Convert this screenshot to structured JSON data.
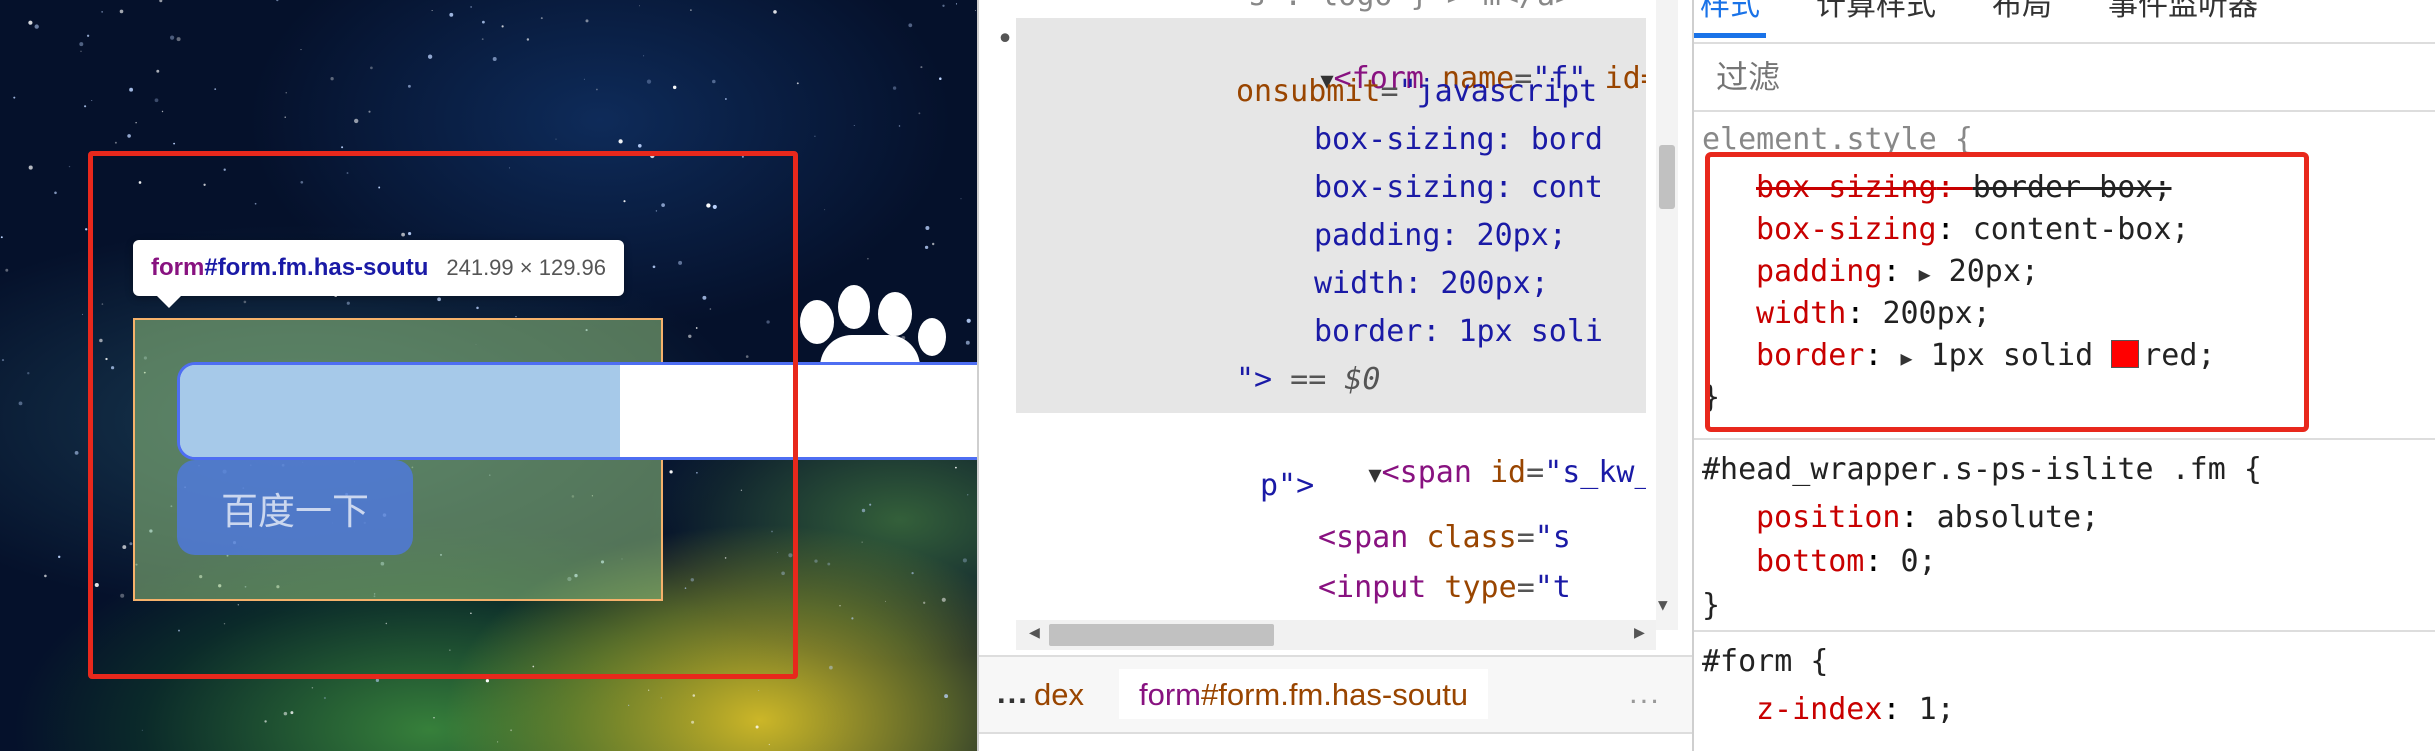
{
  "preview": {
    "submit_button": "百度一下",
    "tooltip": {
      "selector_tag": "form",
      "selector_rest": "#form.fm.has-soutu",
      "size": "241.99 × 129.96"
    },
    "colors": {
      "highlight_box": "#e8281c",
      "search_border": "#4e6ef2",
      "content_overlay": "#6fa8dc",
      "padding_overlay": "#93c47d",
      "margin_outline": "#f6b26b"
    }
  },
  "elements_panel": {
    "gutter": "•••",
    "lines": [
      {
        "caret": "▼",
        "open": "<form",
        "attr1": " name",
        "eq1": "=",
        "val1": "\"f\"",
        "attr2": " id="
      },
      {
        "attr": "onsubmit",
        "eq": "=",
        "val": "\"javascript"
      },
      {
        "text": "box-sizing: bord"
      },
      {
        "text": "box-sizing: cont"
      },
      {
        "text": "padding: 20px;"
      },
      {
        "text": "width: 200px;"
      },
      {
        "text": "border: 1px soli"
      },
      {
        "val": "\">",
        "eq": " == ",
        "dollar": "$0"
      },
      {
        "caret": "▼",
        "open": "<span",
        "attr": " id",
        "eq": "=",
        "val": "\"s_kw_w"
      },
      {
        "text": "p\">"
      },
      {
        "open": "<span",
        "attr": " class",
        "eq": "=",
        "val": "\"s"
      },
      {
        "open": "<input",
        "attr": " type",
        "eq": "=",
        "val": "\"t"
      }
    ],
    "top_partial": "s : logo } > m</a>",
    "breadcrumbs": {
      "ellipsis": "...",
      "prev": "dex",
      "current_tag": "form",
      "current_rest": "#form.fm.has-soutu",
      "more": "..."
    }
  },
  "styles_panel": {
    "tabs": [
      "样式",
      "计算样式",
      "布局",
      "事件监听器"
    ],
    "active_tab": 0,
    "filter_placeholder": "过滤",
    "element_style": {
      "selector": "element.style {",
      "props": [
        {
          "name": "box-sizing",
          "value": "border-box;",
          "overridden": true
        },
        {
          "name": "box-sizing",
          "value": "content-box;",
          "overridden": false
        },
        {
          "name": "padding",
          "value": "20px;",
          "expandable": true
        },
        {
          "name": "width",
          "value": "200px;"
        },
        {
          "name": "border",
          "value": "1px solid",
          "color_name": "red;",
          "expandable": true,
          "swatch": "#ff0000"
        }
      ],
      "close": "}"
    },
    "rule2": {
      "selector": "#head_wrapper.s-ps-islite .fm {",
      "props": [
        {
          "name": "position",
          "value": "absolute;"
        },
        {
          "name": "bottom",
          "value": "0;"
        }
      ],
      "close": "}"
    },
    "rule3": {
      "selector": "#form {",
      "props": [
        {
          "name": "z-index",
          "value": "1;"
        }
      ]
    }
  }
}
